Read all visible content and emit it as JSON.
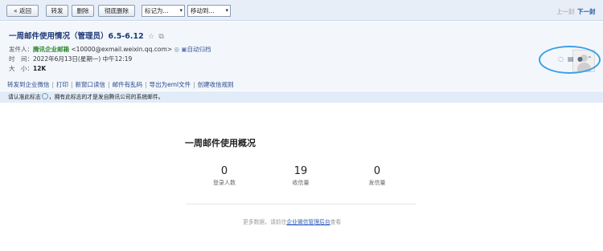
{
  "toolbar": {
    "back": "« 返回",
    "forward": "转发",
    "delete": "删除",
    "delete_forever": "彻底删除",
    "mark_as": "标记为...",
    "move_to": "移动到...",
    "prev": "上一封",
    "next": "下一封"
  },
  "email": {
    "subject": "一周邮件使用情况（管理员）6.5-6.12",
    "sender_label": "发件人：",
    "sender_name": "腾讯企业邮箱",
    "sender_addr": "<10000@exmail.weixin.qq.com>",
    "archive": "自动归档",
    "time_label": "时　间：",
    "time_value": "2022年6月13日(星期一) 中午12:19",
    "size_label": "大　小：",
    "size_value": "12K"
  },
  "actions": [
    "转发到企业微信",
    "打印",
    "新窗口读信",
    "邮件有乱码",
    "导出为eml文件",
    "创建收信规则"
  ],
  "notice": {
    "pre": "请认准此标志",
    "post": "，拥有此标志的才是发自腾讯公司的系统邮件。"
  },
  "content": {
    "title": "一周邮件使用概况",
    "stats": [
      {
        "value": "0",
        "label": "登录人数"
      },
      {
        "value": "19",
        "label": "收信量"
      },
      {
        "value": "0",
        "label": "发信量"
      }
    ],
    "footer_pre": "更多数据，请前往",
    "footer_link": "企业微信管理后台",
    "footer_post": "查看"
  }
}
